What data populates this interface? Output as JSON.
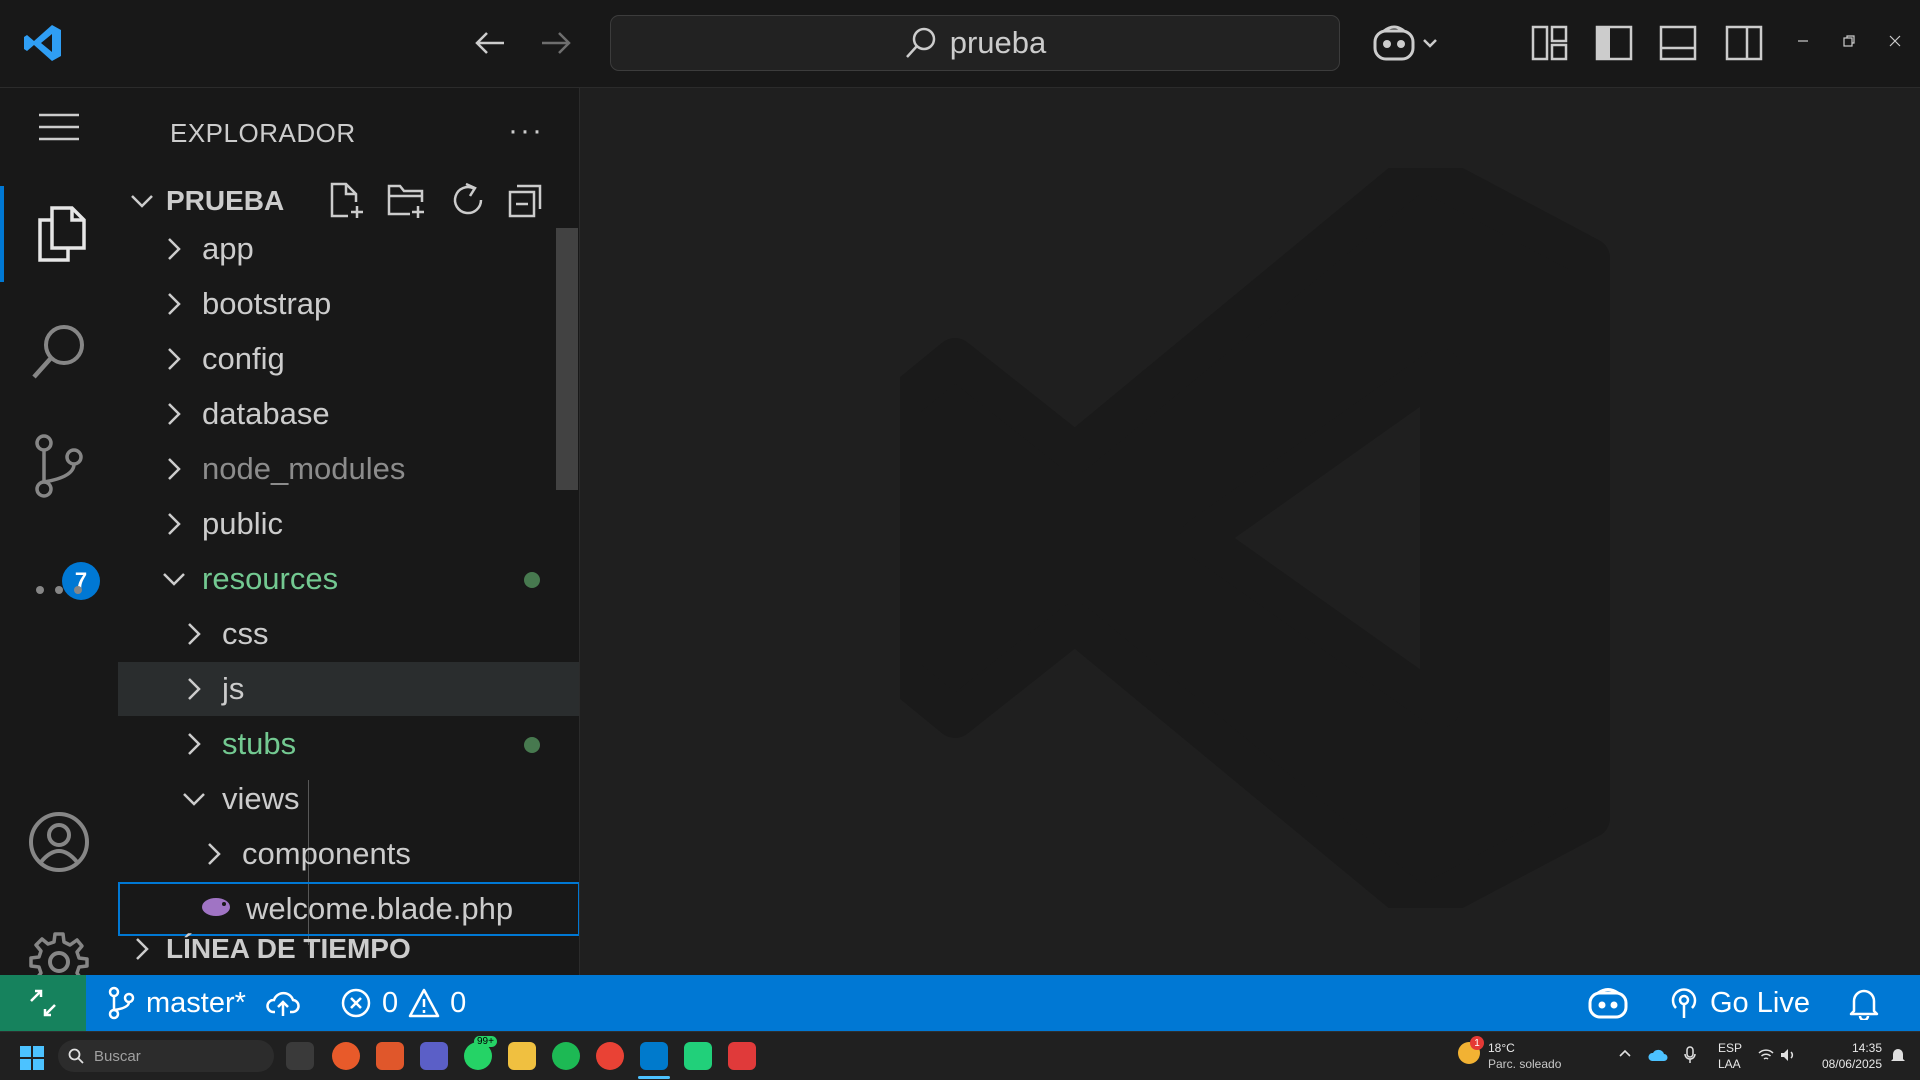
{
  "titlebar": {
    "search_text": "prueba",
    "icons": [
      "vscode-logo-icon",
      "back-arrow-icon",
      "forward-arrow-icon",
      "copilot-icon",
      "customize-layout-icon",
      "toggle-sidebar-icon",
      "toggle-panel-icon",
      "toggle-secondary-sidebar-icon",
      "minimize-icon",
      "restore-icon",
      "close-icon"
    ]
  },
  "activitybar": {
    "source_control_badge": "7",
    "icons": [
      "menu-icon",
      "explorer-icon",
      "search-icon",
      "source-control-icon",
      "more-icon",
      "account-icon",
      "settings-gear-icon"
    ]
  },
  "explorer": {
    "title": "EXPLORADOR",
    "more": "···",
    "folder_name": "PRUEBA",
    "items": [
      {
        "label": "app",
        "state": "collapsed",
        "depth": 1
      },
      {
        "label": "bootstrap",
        "state": "collapsed",
        "depth": 1
      },
      {
        "label": "config",
        "state": "collapsed",
        "depth": 1
      },
      {
        "label": "database",
        "state": "collapsed",
        "depth": 1
      },
      {
        "label": "node_modules",
        "state": "collapsed",
        "depth": 1
      },
      {
        "label": "public",
        "state": "collapsed",
        "depth": 1
      },
      {
        "label": "resources",
        "state": "expanded",
        "depth": 1
      },
      {
        "label": "css",
        "state": "collapsed",
        "depth": 2
      },
      {
        "label": "js",
        "state": "collapsed",
        "depth": 2
      },
      {
        "label": "stubs",
        "state": "collapsed",
        "depth": 2
      },
      {
        "label": "views",
        "state": "expanded",
        "depth": 2
      },
      {
        "label": "components",
        "state": "collapsed",
        "depth": 3
      },
      {
        "label": "welcome.blade.php",
        "state": "file",
        "depth": 3
      }
    ],
    "timeline_title": "LÍNEA DE TIEMPO"
  },
  "statusbar": {
    "branch": "master*",
    "errors": "0",
    "warnings": "0",
    "go_live": "Go Live"
  },
  "taskbar": {
    "search_placeholder": "Buscar",
    "whatsapp_badge": "99+",
    "weather_temp": "18°C",
    "weather_desc": "Parc. soleado",
    "weather_badge": "1",
    "lang_top": "ESP",
    "lang_bottom": "LAA",
    "time": "14:35",
    "date": "08/06/2025"
  },
  "colors": {
    "accent": "#0078d4",
    "git_modified": "#73c991",
    "remote": "#16825d"
  }
}
